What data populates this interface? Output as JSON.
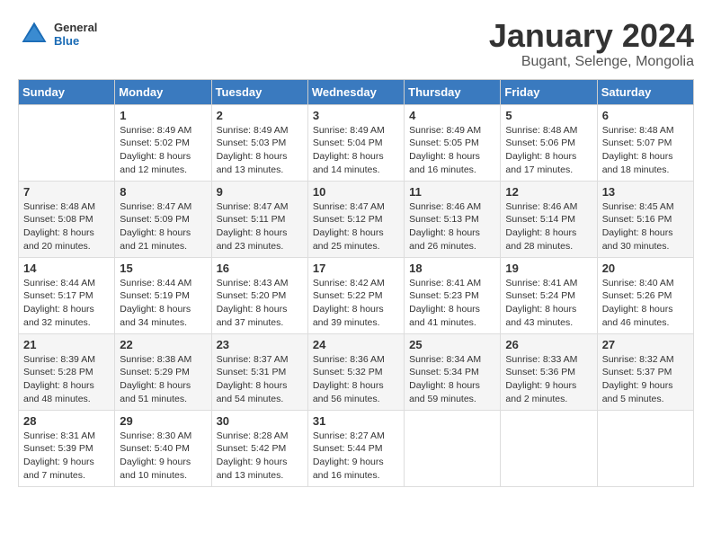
{
  "header": {
    "logo": {
      "general": "General",
      "blue": "Blue"
    },
    "title": "January 2024",
    "location": "Bugant, Selenge, Mongolia"
  },
  "days_of_week": [
    "Sunday",
    "Monday",
    "Tuesday",
    "Wednesday",
    "Thursday",
    "Friday",
    "Saturday"
  ],
  "weeks": [
    [
      {
        "day": "",
        "sunrise": "",
        "sunset": "",
        "daylight": ""
      },
      {
        "day": "1",
        "sunrise": "Sunrise: 8:49 AM",
        "sunset": "Sunset: 5:02 PM",
        "daylight": "Daylight: 8 hours and 12 minutes."
      },
      {
        "day": "2",
        "sunrise": "Sunrise: 8:49 AM",
        "sunset": "Sunset: 5:03 PM",
        "daylight": "Daylight: 8 hours and 13 minutes."
      },
      {
        "day": "3",
        "sunrise": "Sunrise: 8:49 AM",
        "sunset": "Sunset: 5:04 PM",
        "daylight": "Daylight: 8 hours and 14 minutes."
      },
      {
        "day": "4",
        "sunrise": "Sunrise: 8:49 AM",
        "sunset": "Sunset: 5:05 PM",
        "daylight": "Daylight: 8 hours and 16 minutes."
      },
      {
        "day": "5",
        "sunrise": "Sunrise: 8:48 AM",
        "sunset": "Sunset: 5:06 PM",
        "daylight": "Daylight: 8 hours and 17 minutes."
      },
      {
        "day": "6",
        "sunrise": "Sunrise: 8:48 AM",
        "sunset": "Sunset: 5:07 PM",
        "daylight": "Daylight: 8 hours and 18 minutes."
      }
    ],
    [
      {
        "day": "7",
        "sunrise": "Sunrise: 8:48 AM",
        "sunset": "Sunset: 5:08 PM",
        "daylight": "Daylight: 8 hours and 20 minutes."
      },
      {
        "day": "8",
        "sunrise": "Sunrise: 8:47 AM",
        "sunset": "Sunset: 5:09 PM",
        "daylight": "Daylight: 8 hours and 21 minutes."
      },
      {
        "day": "9",
        "sunrise": "Sunrise: 8:47 AM",
        "sunset": "Sunset: 5:11 PM",
        "daylight": "Daylight: 8 hours and 23 minutes."
      },
      {
        "day": "10",
        "sunrise": "Sunrise: 8:47 AM",
        "sunset": "Sunset: 5:12 PM",
        "daylight": "Daylight: 8 hours and 25 minutes."
      },
      {
        "day": "11",
        "sunrise": "Sunrise: 8:46 AM",
        "sunset": "Sunset: 5:13 PM",
        "daylight": "Daylight: 8 hours and 26 minutes."
      },
      {
        "day": "12",
        "sunrise": "Sunrise: 8:46 AM",
        "sunset": "Sunset: 5:14 PM",
        "daylight": "Daylight: 8 hours and 28 minutes."
      },
      {
        "day": "13",
        "sunrise": "Sunrise: 8:45 AM",
        "sunset": "Sunset: 5:16 PM",
        "daylight": "Daylight: 8 hours and 30 minutes."
      }
    ],
    [
      {
        "day": "14",
        "sunrise": "Sunrise: 8:44 AM",
        "sunset": "Sunset: 5:17 PM",
        "daylight": "Daylight: 8 hours and 32 minutes."
      },
      {
        "day": "15",
        "sunrise": "Sunrise: 8:44 AM",
        "sunset": "Sunset: 5:19 PM",
        "daylight": "Daylight: 8 hours and 34 minutes."
      },
      {
        "day": "16",
        "sunrise": "Sunrise: 8:43 AM",
        "sunset": "Sunset: 5:20 PM",
        "daylight": "Daylight: 8 hours and 37 minutes."
      },
      {
        "day": "17",
        "sunrise": "Sunrise: 8:42 AM",
        "sunset": "Sunset: 5:22 PM",
        "daylight": "Daylight: 8 hours and 39 minutes."
      },
      {
        "day": "18",
        "sunrise": "Sunrise: 8:41 AM",
        "sunset": "Sunset: 5:23 PM",
        "daylight": "Daylight: 8 hours and 41 minutes."
      },
      {
        "day": "19",
        "sunrise": "Sunrise: 8:41 AM",
        "sunset": "Sunset: 5:24 PM",
        "daylight": "Daylight: 8 hours and 43 minutes."
      },
      {
        "day": "20",
        "sunrise": "Sunrise: 8:40 AM",
        "sunset": "Sunset: 5:26 PM",
        "daylight": "Daylight: 8 hours and 46 minutes."
      }
    ],
    [
      {
        "day": "21",
        "sunrise": "Sunrise: 8:39 AM",
        "sunset": "Sunset: 5:28 PM",
        "daylight": "Daylight: 8 hours and 48 minutes."
      },
      {
        "day": "22",
        "sunrise": "Sunrise: 8:38 AM",
        "sunset": "Sunset: 5:29 PM",
        "daylight": "Daylight: 8 hours and 51 minutes."
      },
      {
        "day": "23",
        "sunrise": "Sunrise: 8:37 AM",
        "sunset": "Sunset: 5:31 PM",
        "daylight": "Daylight: 8 hours and 54 minutes."
      },
      {
        "day": "24",
        "sunrise": "Sunrise: 8:36 AM",
        "sunset": "Sunset: 5:32 PM",
        "daylight": "Daylight: 8 hours and 56 minutes."
      },
      {
        "day": "25",
        "sunrise": "Sunrise: 8:34 AM",
        "sunset": "Sunset: 5:34 PM",
        "daylight": "Daylight: 8 hours and 59 minutes."
      },
      {
        "day": "26",
        "sunrise": "Sunrise: 8:33 AM",
        "sunset": "Sunset: 5:36 PM",
        "daylight": "Daylight: 9 hours and 2 minutes."
      },
      {
        "day": "27",
        "sunrise": "Sunrise: 8:32 AM",
        "sunset": "Sunset: 5:37 PM",
        "daylight": "Daylight: 9 hours and 5 minutes."
      }
    ],
    [
      {
        "day": "28",
        "sunrise": "Sunrise: 8:31 AM",
        "sunset": "Sunset: 5:39 PM",
        "daylight": "Daylight: 9 hours and 7 minutes."
      },
      {
        "day": "29",
        "sunrise": "Sunrise: 8:30 AM",
        "sunset": "Sunset: 5:40 PM",
        "daylight": "Daylight: 9 hours and 10 minutes."
      },
      {
        "day": "30",
        "sunrise": "Sunrise: 8:28 AM",
        "sunset": "Sunset: 5:42 PM",
        "daylight": "Daylight: 9 hours and 13 minutes."
      },
      {
        "day": "31",
        "sunrise": "Sunrise: 8:27 AM",
        "sunset": "Sunset: 5:44 PM",
        "daylight": "Daylight: 9 hours and 16 minutes."
      },
      {
        "day": "",
        "sunrise": "",
        "sunset": "",
        "daylight": ""
      },
      {
        "day": "",
        "sunrise": "",
        "sunset": "",
        "daylight": ""
      },
      {
        "day": "",
        "sunrise": "",
        "sunset": "",
        "daylight": ""
      }
    ]
  ]
}
